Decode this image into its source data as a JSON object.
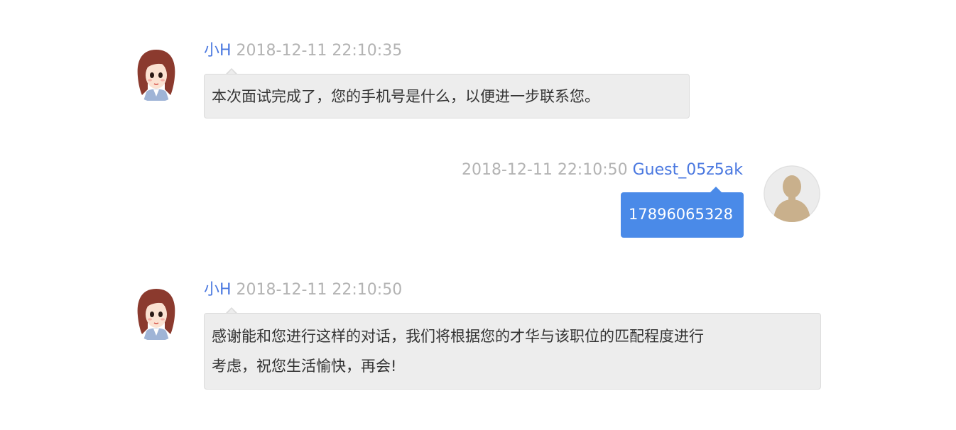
{
  "colors": {
    "name": "#4a78e0",
    "timestamp": "#b3b3b3",
    "incoming_bubble": "#ededed",
    "outgoing_bubble": "#4a8ae8"
  },
  "messages": [
    {
      "direction": "incoming",
      "sender": "小H",
      "time": "2018-12-11 22:10:35",
      "avatar_icon": "cartoon-woman-avatar-icon",
      "lines": [
        "本次面试完成了，您的手机号是什么，以便进一步联系您。"
      ]
    },
    {
      "direction": "outgoing",
      "sender": "Guest_05z5ak",
      "time": "2018-12-11 22:10:50",
      "avatar_icon": "default-user-avatar-icon",
      "lines": [
        "17896065328"
      ]
    },
    {
      "direction": "incoming",
      "sender": "小H",
      "time": "2018-12-11 22:10:50",
      "avatar_icon": "cartoon-woman-avatar-icon",
      "lines": [
        "感谢能和您进行这样的对话，我们将根据您的才华与该职位的匹配程度进行",
        "考虑，祝您生活愉快，再会!"
      ]
    }
  ]
}
